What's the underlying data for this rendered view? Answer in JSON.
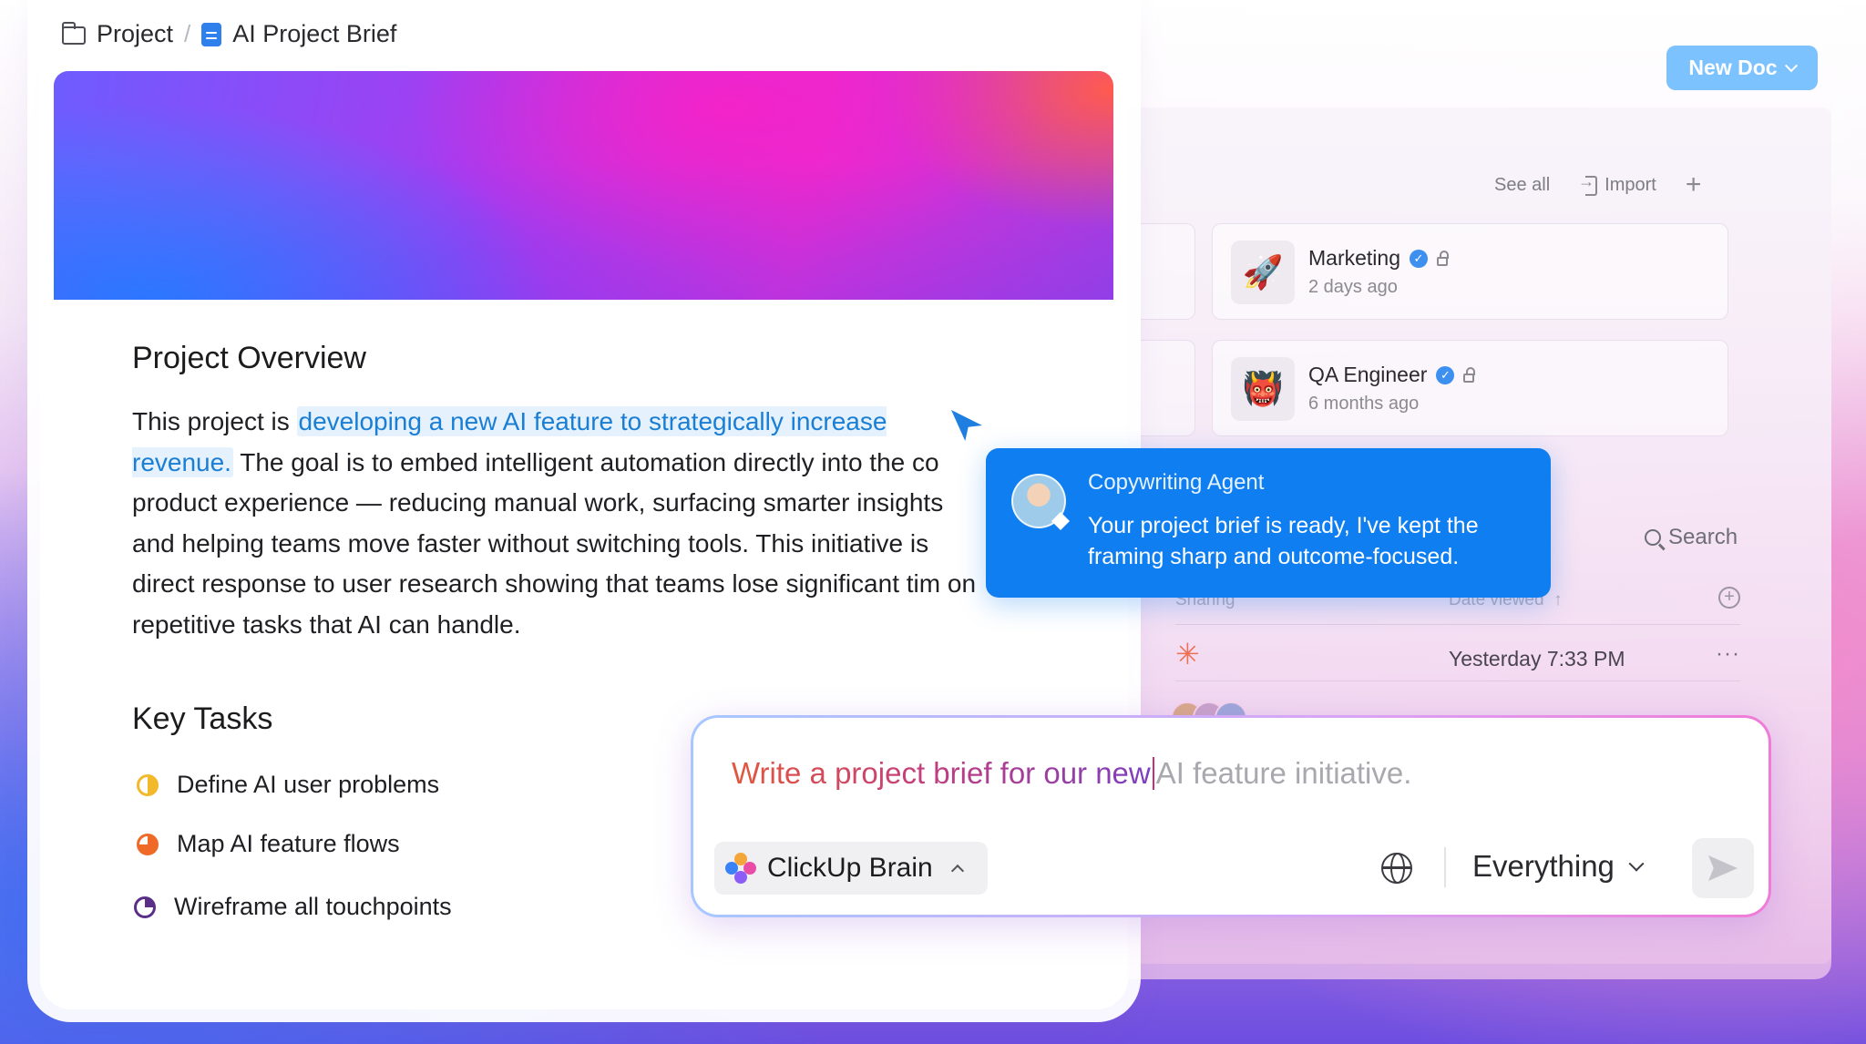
{
  "breadcrumb": {
    "project": "Project",
    "separator": "/",
    "doc_title": "AI Project Brief"
  },
  "document": {
    "overview_heading": "Project Overview",
    "overview_prefix": "This project is ",
    "overview_highlight": "developing a new AI feature to strategically increase revenue.",
    "overview_rest": " The goal is to embed intelligent automation directly into the co product experience — reducing manual work, surfacing smarter insights and helping teams move faster without switching tools. This initiative is direct response to user research showing that teams lose significant tim on repetitive tasks that AI can handle.",
    "tasks_heading": "Key Tasks",
    "tasks": [
      {
        "label": "Define AI user problems",
        "icon": "half-circle-status-icon",
        "color": "#f2b92a"
      },
      {
        "label": "Map AI feature flows",
        "icon": "three-quarter-circle-status-icon",
        "color": "#ef6a26"
      },
      {
        "label": "Wireframe all touchpoints",
        "icon": "quarter-circle-status-icon",
        "color": "#5a2f88"
      }
    ]
  },
  "right_panel": {
    "new_doc_label": "New Doc",
    "see_all_label": "See all",
    "import_label": "Import",
    "recent_docs": [
      {
        "title": "Marketing",
        "time": "2 days ago",
        "icon": "rocket-icon"
      },
      {
        "title": "QA Engineer",
        "time": "6 months ago",
        "icon": "monster-icon"
      }
    ],
    "search_label": "Search",
    "table": {
      "col_sharing": "Sharing",
      "col_date_viewed": "Date viewed",
      "sort_arrow": "↑",
      "row_date": "Yesterday 7:33 PM",
      "row_more": "···"
    }
  },
  "agent_popup": {
    "name": "Copywriting Agent",
    "message": "Your project brief is ready, I've kept the framing sharp and outcome-focused."
  },
  "prompt_bar": {
    "typed_text": "Write a project brief for our new",
    "ghost_text": "AI feature initiative.",
    "brain_label": "ClickUp Brain",
    "scope_label": "Everything"
  },
  "colors": {
    "accent_blue": "#0f7ef0",
    "new_doc_bg": "#7cc2ff",
    "highlight_text": "#1a7fd4"
  }
}
